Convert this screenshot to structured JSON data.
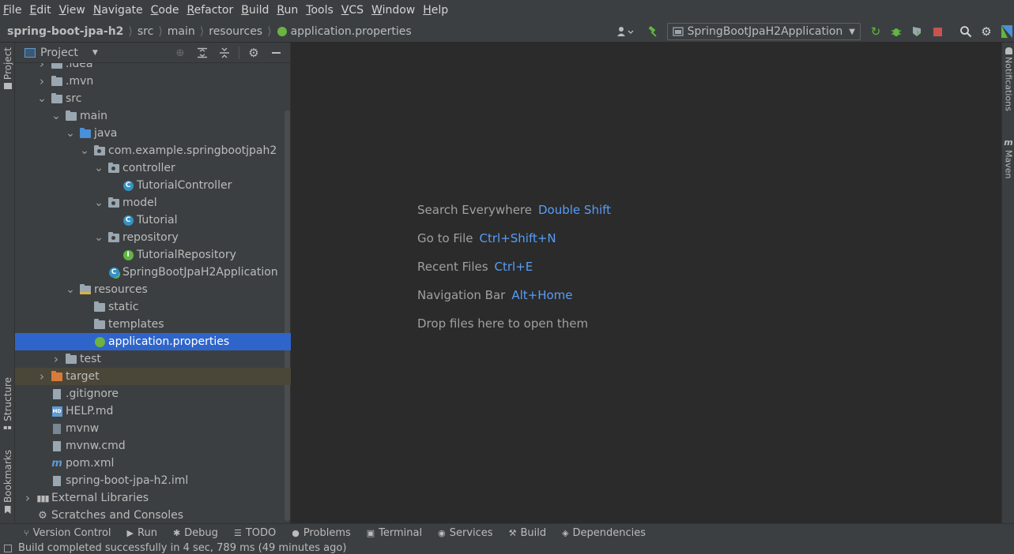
{
  "menu": [
    "File",
    "Edit",
    "View",
    "Navigate",
    "Code",
    "Refactor",
    "Build",
    "Run",
    "Tools",
    "VCS",
    "Window",
    "Help"
  ],
  "breadcrumb": [
    "spring-boot-jpa-h2",
    "src",
    "main",
    "resources",
    "application.properties"
  ],
  "run_config": "SpringBootJpaH2Application",
  "left_tabs": {
    "project": "Project",
    "structure": "Structure",
    "bookmarks": "Bookmarks"
  },
  "right_tabs": {
    "notifications": "Notifications",
    "maven": "Maven"
  },
  "panel": {
    "title": "Project"
  },
  "tree": [
    {
      "label": ".idea",
      "level": 1,
      "arrow": "right",
      "icon": "folder"
    },
    {
      "label": ".mvn",
      "level": 1,
      "arrow": "right",
      "icon": "folder"
    },
    {
      "label": "src",
      "level": 1,
      "arrow": "down",
      "icon": "folder"
    },
    {
      "label": "main",
      "level": 2,
      "arrow": "down",
      "icon": "folder"
    },
    {
      "label": "java",
      "level": 3,
      "arrow": "down",
      "icon": "folder-blue"
    },
    {
      "label": "com.example.springbootjpah2",
      "level": 4,
      "arrow": "down",
      "icon": "package"
    },
    {
      "label": "controller",
      "level": 5,
      "arrow": "down",
      "icon": "package"
    },
    {
      "label": "TutorialController",
      "level": 6,
      "arrow": "",
      "icon": "class"
    },
    {
      "label": "model",
      "level": 5,
      "arrow": "down",
      "icon": "package"
    },
    {
      "label": "Tutorial",
      "level": 6,
      "arrow": "",
      "icon": "class"
    },
    {
      "label": "repository",
      "level": 5,
      "arrow": "down",
      "icon": "package"
    },
    {
      "label": "TutorialRepository",
      "level": 6,
      "arrow": "",
      "icon": "interface"
    },
    {
      "label": "SpringBootJpaH2Application",
      "level": 5,
      "arrow": "",
      "icon": "spring-class"
    },
    {
      "label": "resources",
      "level": 3,
      "arrow": "down",
      "icon": "folder-res"
    },
    {
      "label": "static",
      "level": 4,
      "arrow": "",
      "icon": "folder"
    },
    {
      "label": "templates",
      "level": 4,
      "arrow": "",
      "icon": "folder"
    },
    {
      "label": "application.properties",
      "level": 4,
      "arrow": "",
      "icon": "spring-file",
      "selected": true
    },
    {
      "label": "test",
      "level": 2,
      "arrow": "right",
      "icon": "folder"
    },
    {
      "label": "target",
      "level": 1,
      "arrow": "right",
      "icon": "folder-orange",
      "excluded": true
    },
    {
      "label": ".gitignore",
      "level": 1,
      "arrow": "",
      "icon": "file"
    },
    {
      "label": "HELP.md",
      "level": 1,
      "arrow": "",
      "icon": "md"
    },
    {
      "label": "mvnw",
      "level": 1,
      "arrow": "",
      "icon": "exec"
    },
    {
      "label": "mvnw.cmd",
      "level": 1,
      "arrow": "",
      "icon": "file"
    },
    {
      "label": "pom.xml",
      "level": 1,
      "arrow": "",
      "icon": "maven"
    },
    {
      "label": "spring-boot-jpa-h2.iml",
      "level": 1,
      "arrow": "",
      "icon": "file"
    },
    {
      "label": "External Libraries",
      "level": 0,
      "arrow": "right",
      "icon": "libs"
    },
    {
      "label": "Scratches and Consoles",
      "level": 0,
      "arrow": "",
      "icon": "scratch"
    }
  ],
  "hints": [
    {
      "text": "Search Everywhere",
      "key": "Double Shift"
    },
    {
      "text": "Go to File",
      "key": "Ctrl+Shift+N"
    },
    {
      "text": "Recent Files",
      "key": "Ctrl+E"
    },
    {
      "text": "Navigation Bar",
      "key": "Alt+Home"
    },
    {
      "text": "Drop files here to open them",
      "key": ""
    }
  ],
  "bottom_tools": [
    {
      "label": "Version Control",
      "icon": "vcs-icon"
    },
    {
      "label": "Run",
      "icon": "run-icon"
    },
    {
      "label": "Debug",
      "icon": "debug-icon"
    },
    {
      "label": "TODO",
      "icon": "todo-icon"
    },
    {
      "label": "Problems",
      "icon": "problems-icon"
    },
    {
      "label": "Terminal",
      "icon": "terminal-icon"
    },
    {
      "label": "Services",
      "icon": "services-icon"
    },
    {
      "label": "Build",
      "icon": "build-icon"
    },
    {
      "label": "Dependencies",
      "icon": "dependencies-icon"
    }
  ],
  "status": "Build completed successfully in 4 sec, 789 ms (49 minutes ago)",
  "colors": {
    "selection": "#2f65ca",
    "accent_key": "#589df6",
    "excluded_bg": "#4a4638"
  }
}
